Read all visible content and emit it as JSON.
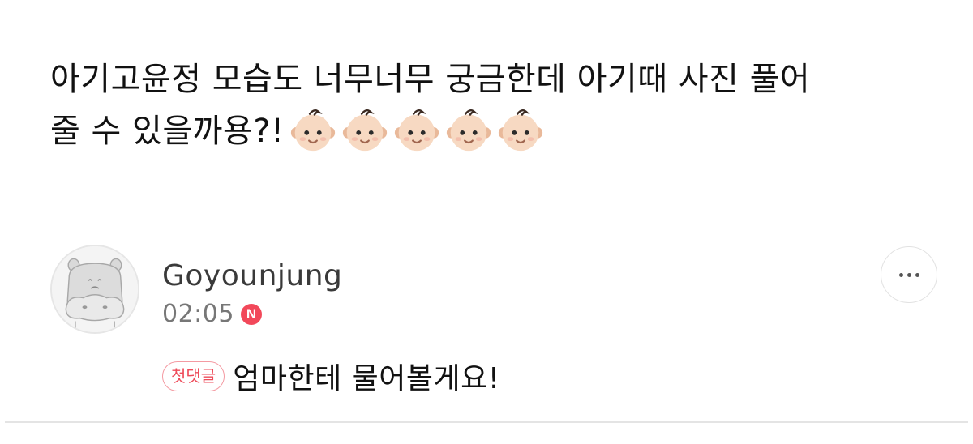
{
  "post": {
    "line1": "아기고윤정 모습도 너무너무 궁금한데 아기때 사진 풀어",
    "line2": "줄 수 있을까용?!",
    "emoji": [
      "baby-emoji",
      "baby-emoji",
      "baby-emoji",
      "baby-emoji",
      "baby-emoji"
    ]
  },
  "comment": {
    "author": "Goyounjung",
    "time": "02:05",
    "new_badge": "N",
    "first_badge": "첫댓글",
    "text": "엄마한테 물어볼게요!",
    "avatar_icon": "hippo-avatar-icon",
    "more_icon": "more-dots-icon"
  },
  "colors": {
    "accent_red": "#f2485a",
    "badge_border": "#f49aa2",
    "text_gray": "#777777"
  }
}
